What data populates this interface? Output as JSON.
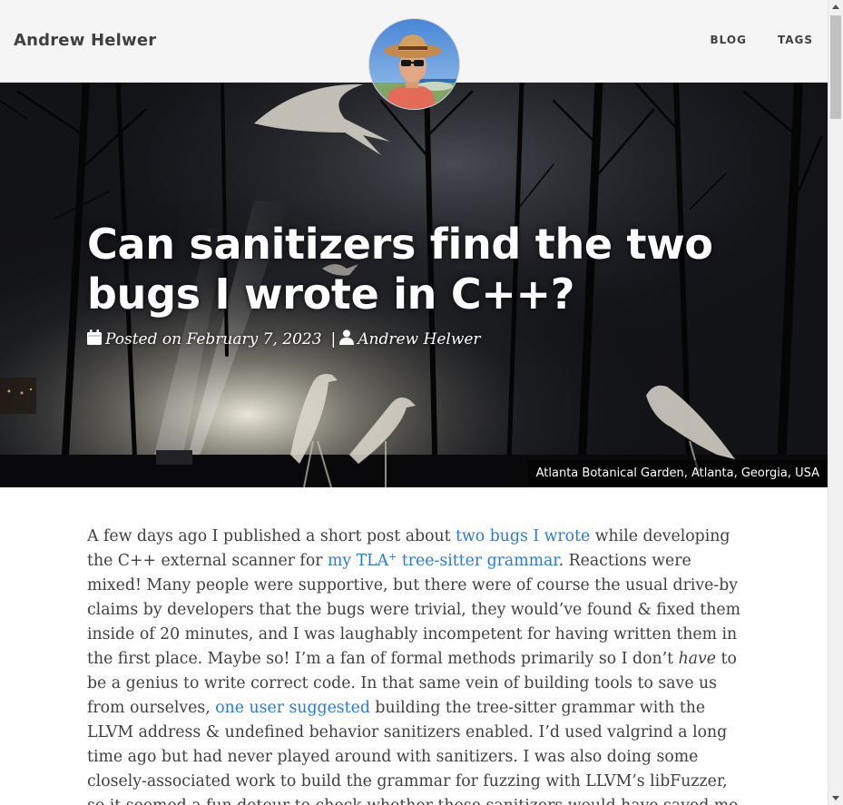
{
  "navbar": {
    "brand": "Andrew Helwer",
    "links": [
      {
        "label": "BLOG"
      },
      {
        "label": "TAGS"
      }
    ]
  },
  "hero": {
    "title": "Can sanitizers find the two bugs I wrote in C++?",
    "posted_on": "Posted on February 7, 2023",
    "separator": "|",
    "author": "Andrew Helwer",
    "caption": "Atlanta Botanical Garden, Atlanta, Georgia, USA",
    "icons": [
      "calendar-icon",
      "user-icon"
    ]
  },
  "article": {
    "p1": {
      "t1": "A few days ago I published a short post about ",
      "link1": "two bugs I wrote",
      "t2": " while developing the C++ external scanner for ",
      "link2_a": "my TLA",
      "link2_sup": "+",
      "link2_b": " tree-sitter grammar",
      "t3": ". Reactions were mixed! Many people were supportive, but there were of course the usual drive-by claims by developers that the bugs were trivial, they would’ve found & fixed them inside of 20 minutes, and I was laughably incompetent for having written them in the first place. Maybe so! I’m a fan of formal methods primarily so I don’t ",
      "em": "have",
      "t4": " to be a genius to write correct code. In that same vein of building tools to save us from ourselves, ",
      "link3": "one user suggested",
      "t5": " building the tree-sitter grammar with the LLVM address & undefined behavior sanitizers enabled. I’d used valgrind a long time ago but had never played around with sanitizers. I was also doing some closely-associated work to build the grammar for fuzzing with LLVM’s libFuzzer, so it seemed a fun detour to check whether those sanitizers would have saved me days of debugging pain!"
    }
  },
  "colors": {
    "link": "#2a7ae2",
    "text": "#404040",
    "navbar_bg": "#f5f5f5"
  }
}
